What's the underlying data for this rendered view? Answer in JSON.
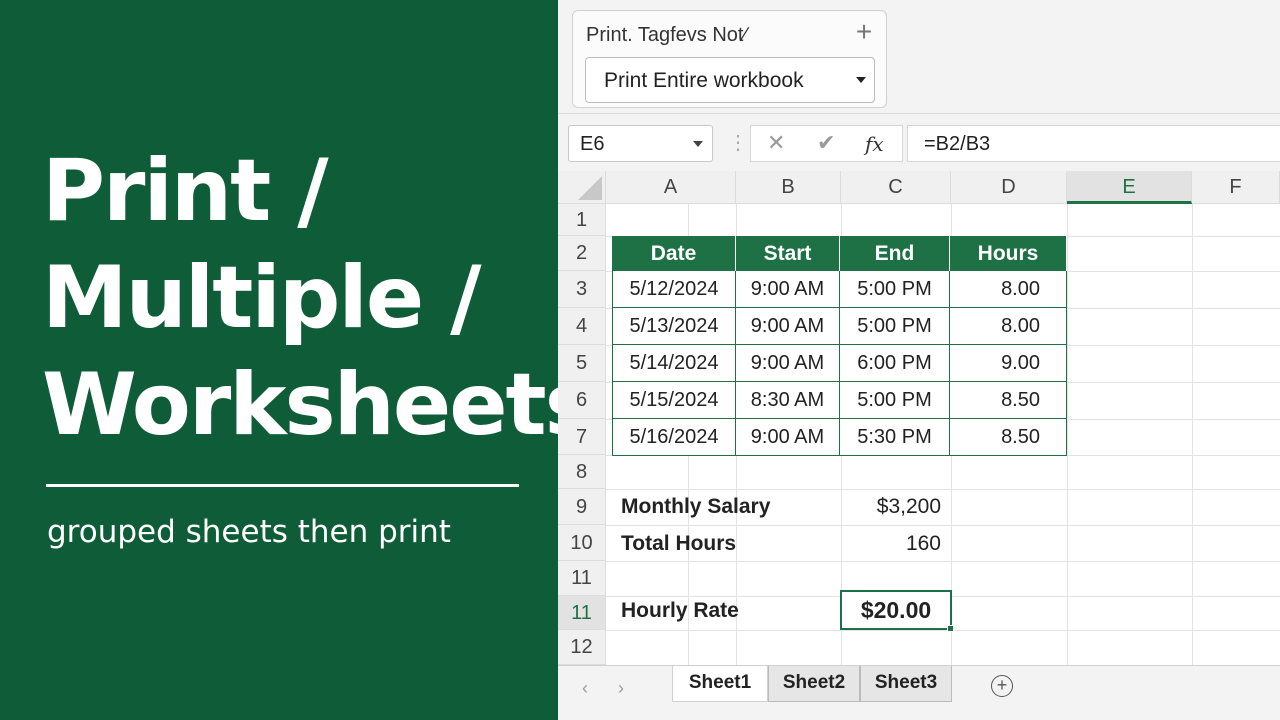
{
  "headline": {
    "line1": "Print /",
    "line2": "Multiple /",
    "line3": "Worksheets",
    "subtitle": "grouped sheets then print"
  },
  "print_pane": {
    "title": "Print. Tagfevs Not∕",
    "add_icon": "plus-icon",
    "dropdown_value": "Print Entire workbook"
  },
  "formula_bar": {
    "name_box": "E6",
    "cancel_icon": "✕",
    "enter_icon": "✔",
    "fx_label": "fx",
    "formula": "=B2/B3"
  },
  "grid": {
    "columns": [
      "A",
      "B",
      "C",
      "D",
      "E",
      "F"
    ],
    "active_column": "E",
    "rows": [
      "1",
      "2",
      "3",
      "4",
      "5",
      "6",
      "7",
      "8",
      "9",
      "10",
      "11",
      "11",
      "12"
    ],
    "table": {
      "headers": [
        "Date",
        "Start",
        "End",
        "Hours"
      ],
      "rows": [
        [
          "5/12/2024",
          "9:00 AM",
          "5:00 PM",
          "8.00"
        ],
        [
          "5/13/2024",
          "9:00 AM",
          "5:00 PM",
          "8.00"
        ],
        [
          "5/14/2024",
          "9:00 AM",
          "6:00 PM",
          "9.00"
        ],
        [
          "5/15/2024",
          "8:30 AM",
          "5:00 PM",
          "8.50"
        ],
        [
          "5/16/2024",
          "9:00 AM",
          "5:30 PM",
          "8.50"
        ]
      ],
      "header_color": "#1e7145"
    },
    "summary": {
      "salary_label": "Monthly Salary",
      "salary_value": "$3,200",
      "hours_label": "Total Hours",
      "hours_value": "160",
      "rate_label": "Hourly Rate",
      "rate_value": "$20.00"
    }
  },
  "sheets": {
    "prev_icon": "‹",
    "next_icon": "›",
    "tabs": [
      "Sheet1",
      "Sheet2",
      "Sheet3"
    ],
    "active": "Sheet1",
    "add_icon": "+"
  },
  "colors": {
    "panel_green": "#0f5d38",
    "excel_green": "#1e7145"
  }
}
